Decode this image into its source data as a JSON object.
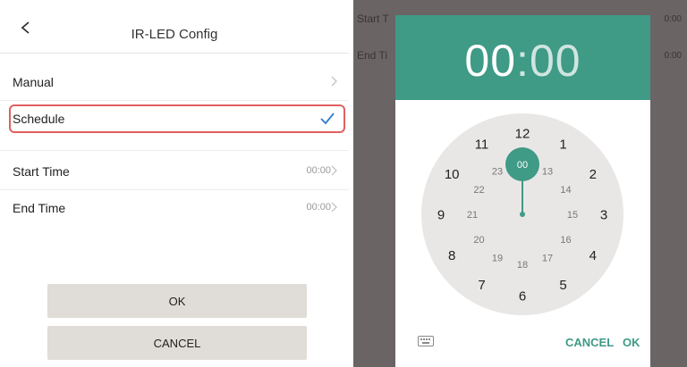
{
  "left": {
    "header": {
      "title": "IR-LED Config"
    },
    "options": [
      {
        "label": "Manual"
      },
      {
        "label": "Schedule"
      }
    ],
    "settings": [
      {
        "label": "Start Time",
        "value": "00:00"
      },
      {
        "label": "End Time",
        "value": "00:00"
      }
    ],
    "buttons": {
      "ok": "OK",
      "cancel": "CANCEL"
    }
  },
  "right": {
    "background_rows": [
      {
        "label": "Start T",
        "value": "0:00"
      },
      {
        "label": "End Ti",
        "value": "0:00"
      }
    ],
    "dialog": {
      "time": {
        "hours": "00",
        "separator": ":",
        "minutes": "00"
      },
      "selected_hour": "00",
      "outer_hours": [
        "12",
        "1",
        "2",
        "3",
        "4",
        "5",
        "6",
        "7",
        "8",
        "9",
        "10",
        "11"
      ],
      "inner_hours": [
        "00",
        "13",
        "14",
        "15",
        "16",
        "17",
        "18",
        "19",
        "20",
        "21",
        "22",
        "23"
      ],
      "cancel": "CANCEL",
      "ok": "OK"
    }
  },
  "colors": {
    "accent": "#3f9a86",
    "highlight": "#e06060",
    "check": "#2e7ad1"
  },
  "icons": [
    "back-arrow-icon",
    "chevron-right-icon",
    "checkmark-icon",
    "keyboard-icon"
  ]
}
